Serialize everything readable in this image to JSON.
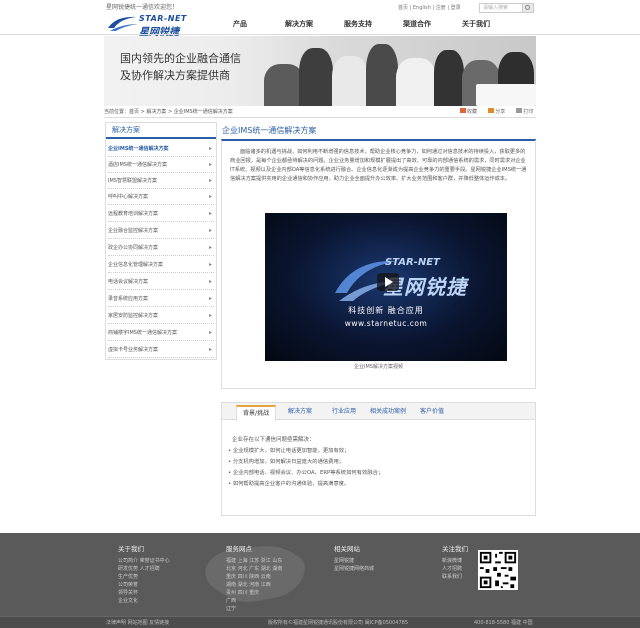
{
  "topbar": {
    "welcome": "星网锐捷统一通信欢迎您！",
    "links": "首页 | English | 注册 | 登录",
    "search_placeholder": "请输入搜索"
  },
  "logo": {
    "en": "STAR-NET",
    "cn": "星网锐捷"
  },
  "nav": {
    "items": [
      "产品",
      "解决方案",
      "服务支持",
      "渠道合作",
      "关于我们"
    ]
  },
  "banner": {
    "line1": "国内领先的企业融合通信",
    "line2": "及协作解决方案提供商"
  },
  "breadcrumb": "当前位置：首页 > 解决方案 > 企业IMS统一通信解决方案",
  "share": {
    "collect": "收藏",
    "share": "分享",
    "print": "打印"
  },
  "sidebar": {
    "title": "解决方案",
    "items": [
      "企业IMS统一通信解决方案",
      "酒店IMS统一通信解决方案",
      "IMS智慧联盟解决方案",
      "呼叫中心解决方案",
      "远程教育培训解决方案",
      "企业融合监控解决方案",
      "政企办公协同解决方案",
      "企业信息化管理解决方案",
      "电话会议解决方案",
      "录音系统应用方案",
      "家居安防监控解决方案",
      "商铺楼宇IMS统一通信解决方案",
      "虚拟卡号业务解决方案"
    ]
  },
  "main": {
    "title": "企业IMS统一通信解决方案",
    "intro": "面临诸多的机遇与挑战，如何利用不断增强的信息技术，帮助企业核心竞争力，如何通过对信息技术的持续投入，获取更多的商业回报，是每个企业都亟待解决的问题。企业业务量增加和规模扩展提出了高效、可靠的内部通信系统的需求，同时需求对企业IT系统、视频以及企业内部OA等信息化系统进行融合。企业信息化逐渐成为提高企业竞争力的重要手段。星网锐捷企业IMS统一通信解决方案提供实用的企业通信和协作应用，助力企业全面提升办公效率、扩大业务范围和客户群，并降低整体运作成本。",
    "video": {
      "logo_en": "STAR-NET",
      "logo_cn": "星网锐捷",
      "slogan": "科技创新 融合应用",
      "url": "www.starnetuc.com",
      "caption": "企业IMS解决方案视频"
    }
  },
  "tabs": {
    "items": [
      "背景/挑战",
      "解决方案",
      "行业应用",
      "相关成功案例",
      "客户价值"
    ],
    "lead": "企业存在以下通信问题亟需解决：",
    "bullets": [
      "企业规模扩大，如何让电话更加智能，更加有效；",
      "分支机构增加，如何解决日益庞大的通信费用；",
      "企业内部电话、视频会议、办公OA、ERP等系统如何有效融合；",
      "如何帮助提高企业客户的沟通体验，提高满意度。"
    ]
  },
  "footer": {
    "about": {
      "title": "关于我们",
      "lines": [
        "公司简介  荣誉证书中心",
        "研发优势  人才招聘",
        "生产优势",
        "公司荣誉",
        "领导关怀",
        "企业文化"
      ]
    },
    "service": {
      "title": "服务网点",
      "lines": [
        "福建  上海  江苏  浙江  山东",
        "北京  河北  广东  湖北  湖南",
        "重庆  四川  陕西  云南",
        "湖南  湖北  河南  江西",
        "贵州  四川  重庆",
        "广西",
        "辽宁"
      ]
    },
    "links": {
      "title": "相关网站",
      "lines": [
        "星网锐捷",
        "星网锐捷网络商城"
      ]
    },
    "follow": {
      "title": "关注我们",
      "lines": [
        "新浪微博",
        "人才招聘",
        "联系我们"
      ]
    },
    "bottom_left": "法律声明  网站地图  友情链接",
    "bottom_mid": "版权所有©福建星网锐捷通讯股份有限公司  闽ICP备05004785",
    "bottom_right": "400-818-5580  福建  中国"
  }
}
